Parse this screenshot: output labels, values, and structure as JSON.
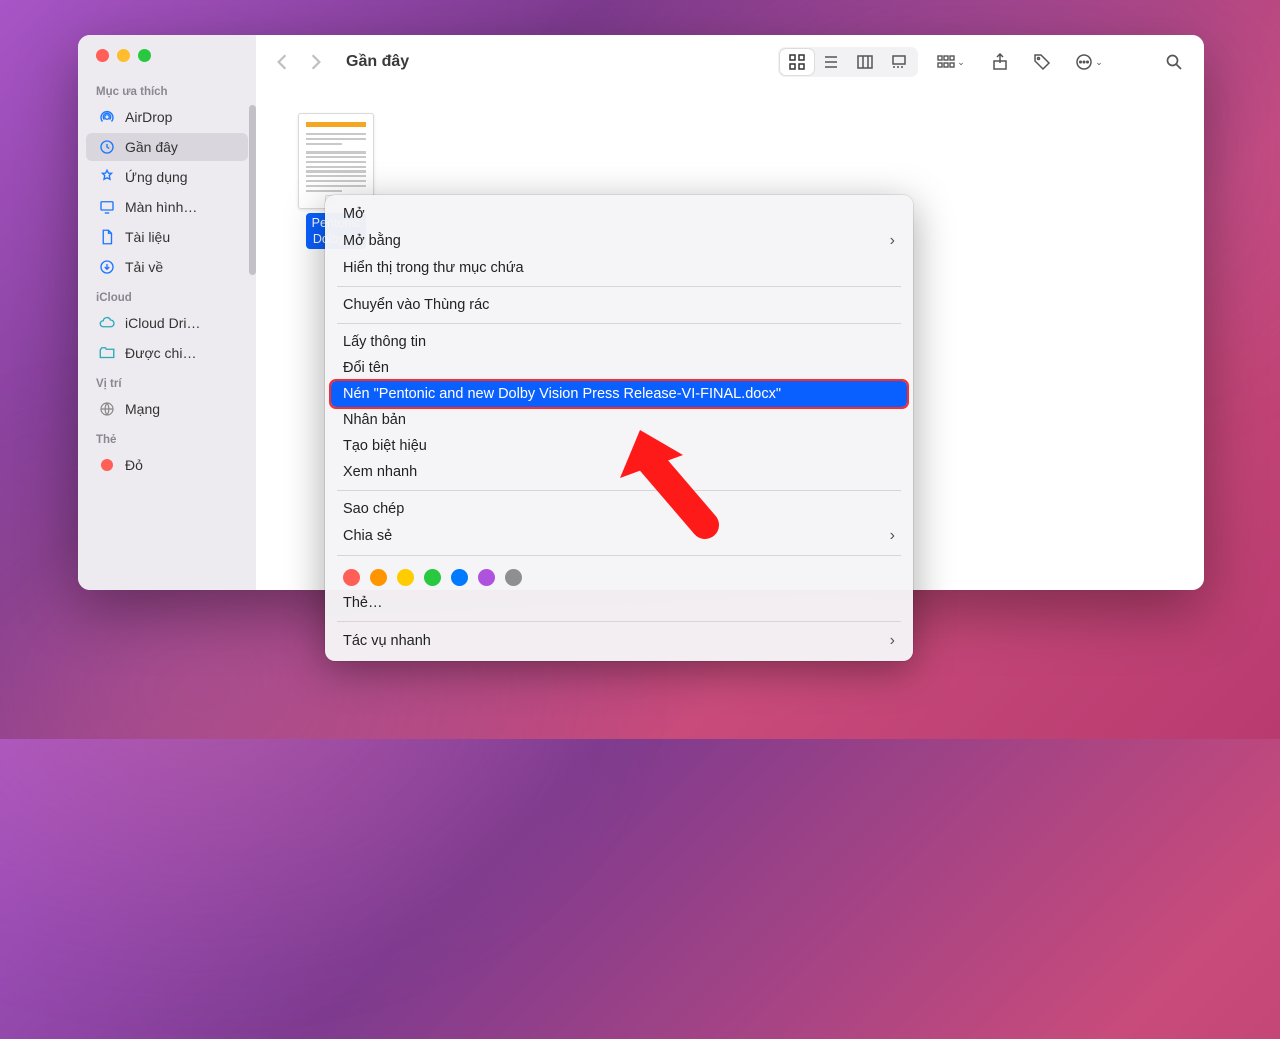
{
  "window_title": "Gần đây",
  "sidebar": {
    "sections": {
      "favorites": "Mục ưa thích",
      "icloud": "iCloud",
      "locations": "Vị trí",
      "tags": "Thẻ"
    },
    "items": {
      "airdrop": "AirDrop",
      "recents": "Gần đây",
      "apps": "Ứng dụng",
      "screens": "Màn hình…",
      "documents": "Tài liệu",
      "downloads": "Tải về",
      "icloud_drive": "iCloud Dri…",
      "shared": "Được chi…",
      "network": "Mạng",
      "red_tag": "Đỏ"
    }
  },
  "file": {
    "label_line1": "Pentonic",
    "label_line2": "Dolby Vi",
    "badge": "D…"
  },
  "context_menu": {
    "open": "Mở",
    "open_with": "Mở bằng",
    "show_in_folder": "Hiển thị trong thư mục chứa",
    "move_to_trash": "Chuyển vào Thùng rác",
    "get_info": "Lấy thông tin",
    "rename": "Đổi tên",
    "compress": "Nén \"Pentonic and new Dolby Vision Press Release-VI-FINAL.docx\"",
    "duplicate": "Nhân bản",
    "make_alias": "Tạo biệt hiệu",
    "quick_look": "Xem nhanh",
    "copy": "Sao chép",
    "share": "Chia sẻ",
    "tags": "Thẻ…",
    "quick_actions": "Tác vụ nhanh"
  }
}
